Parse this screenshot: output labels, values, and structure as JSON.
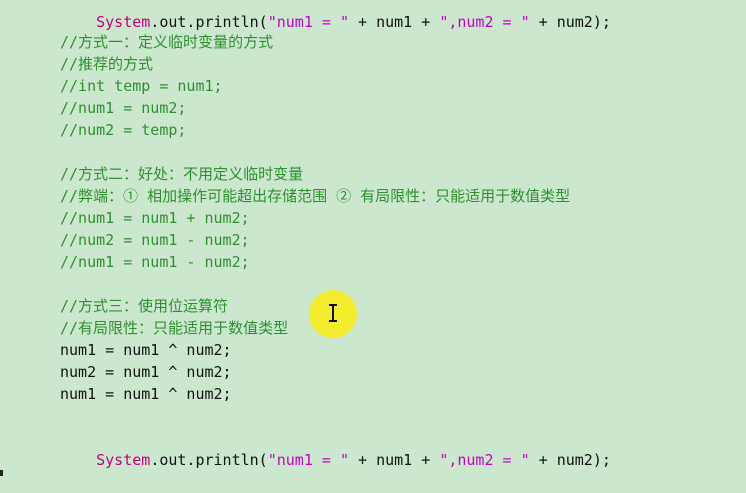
{
  "editor": {
    "lines": [
      {
        "id": "l0",
        "type": "code",
        "parts": [
          "System",
          ".out.println(",
          "\"num1 = \"",
          " + num1 + ",
          "\",num2 = \"",
          " + num2);"
        ]
      },
      {
        "id": "l1",
        "type": "blank",
        "text": ""
      },
      {
        "id": "l2",
        "type": "comment",
        "text": "//方式一：定义临时变量的方式"
      },
      {
        "id": "l3",
        "type": "comment",
        "text": "//推荐的方式"
      },
      {
        "id": "l4",
        "type": "comment",
        "text": "//int temp = num1;"
      },
      {
        "id": "l5",
        "type": "comment",
        "text": "//num1 = num2;"
      },
      {
        "id": "l6",
        "type": "comment",
        "text": "//num2 = temp;"
      },
      {
        "id": "l7",
        "type": "blank",
        "text": ""
      },
      {
        "id": "l8",
        "type": "comment",
        "text": "//方式二：好处：不用定义临时变量"
      },
      {
        "id": "l9",
        "type": "comment",
        "text": "//弊端：① 相加操作可能超出存储范围 ② 有局限性：只能适用于数值类型"
      },
      {
        "id": "l10",
        "type": "comment",
        "text": "//num1 = num1 + num2;"
      },
      {
        "id": "l11",
        "type": "comment",
        "text": "//num2 = num1 - num2;"
      },
      {
        "id": "l12",
        "type": "comment",
        "text": "//num1 = num1 - num2;"
      },
      {
        "id": "l13",
        "type": "blank",
        "text": ""
      },
      {
        "id": "l14",
        "type": "comment",
        "text": "//方式三：使用位运算符"
      },
      {
        "id": "l15",
        "type": "comment",
        "text": "//有局限性：只能适用于数值类型"
      },
      {
        "id": "l16",
        "type": "plain",
        "text": "num1 = num1 ^ num2;"
      },
      {
        "id": "l17",
        "type": "plain",
        "text": "num2 = num1 ^ num2;"
      },
      {
        "id": "l18",
        "type": "plain",
        "text": "num1 = num1 ^ num2;"
      },
      {
        "id": "l19",
        "type": "blank",
        "text": ""
      },
      {
        "id": "l20",
        "type": "code",
        "parts": [
          "System",
          ".out.println(",
          "\"num1 = \"",
          " + num1 + ",
          "\",num2 = \"",
          " + num2);"
        ]
      }
    ]
  },
  "colors": {
    "background": "#cbe8cf",
    "comment": "#2f8f2f",
    "class_name": "#c4007a",
    "string": "#c400c4",
    "plain": "#111111",
    "cursor_highlight": "#ffee00"
  },
  "icons": {
    "mouse_cursor": "i-beam-cursor-icon"
  }
}
